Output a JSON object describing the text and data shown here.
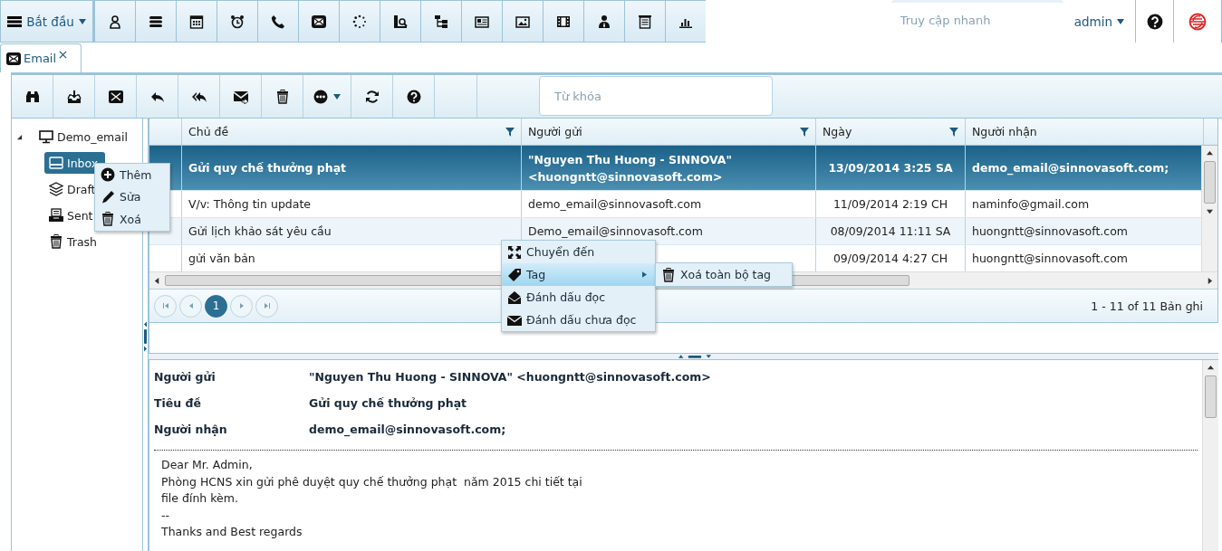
{
  "top_bar": {
    "start_button": "Bắt đầu",
    "quick_access": {
      "placeholder": "Truy cập nhanh"
    },
    "user": "admin"
  },
  "tabs": [
    {
      "label": "Email",
      "selected": true
    }
  ],
  "search": {
    "placeholder": "Từ khóa"
  },
  "folder_tree": {
    "label": "Demo_email",
    "expanded": true,
    "children": [
      {
        "label": "Inbox",
        "selected": true
      },
      {
        "label": "Draft",
        "selected": false
      },
      {
        "label": "Sent",
        "selected": false
      },
      {
        "label": "Trash",
        "selected": false
      }
    ]
  },
  "folder_menu": [
    "Thêm",
    "Sửa",
    "Xoá"
  ],
  "table": {
    "columns": [
      {
        "label": "Chủ đề",
        "filter": true
      },
      {
        "label": "Người gửi",
        "filter": true
      },
      {
        "label": "Ngày",
        "filter": true
      },
      {
        "label": "Người nhận",
        "filter": false
      }
    ],
    "rows": [
      {
        "subject": "Gửi quy chế thưởng phạt",
        "sender": "\"Nguyen Thu Huong - SINNOVA\" <huongntt@sinnovasoft.com>",
        "date": "13/09/2014 3:25 SA",
        "recipient": "demo_email@sinnovasoft.com;",
        "selected": true
      },
      {
        "subject": "V/v: Thông tin update",
        "sender": "demo_email@sinnovasoft.com",
        "date": "11/09/2014 2:19 CH",
        "recipient": "naminfo@gmail.com",
        "selected": false
      },
      {
        "subject": "Gửi lịch khảo sát yêu cầu",
        "sender": "Demo_email@sinnovasoft.com",
        "date": "08/09/2014 11:11 SA",
        "recipient": "huongntt@sinnovasoft.com",
        "selected": false
      },
      {
        "subject": "gửi văn bản",
        "date": "09/09/2014 4:27 CH",
        "recipient": "huongntt@sinnovasoft.com",
        "selected": false
      }
    ]
  },
  "pager": {
    "pages": [
      {
        "label": "1",
        "selected": true
      }
    ],
    "summary": "1 - 11 of 11 Bản ghi"
  },
  "context_menu": {
    "items": [
      {
        "label": "Chuyển đến",
        "highlighted": false
      },
      {
        "label": "Tag",
        "highlighted": true,
        "submenu": [
          "Xoá toàn bộ tag"
        ]
      },
      {
        "label": "Đánh dấu đọc",
        "highlighted": false
      },
      {
        "label": "Đánh dấu chưa đọc",
        "highlighted": false
      }
    ]
  },
  "preview": {
    "fields": [
      {
        "label": "Người gửi",
        "value": "\"Nguyen Thu Huong - SINNOVA\" <huongntt@sinnovasoft.com>"
      },
      {
        "label": "Tiêu đề",
        "value": "Gửi quy chế thưởng phạt"
      },
      {
        "label": "Người nhận",
        "value": "demo_email@sinnovasoft.com;"
      }
    ],
    "body": [
      "Dear Mr. Admin,",
      "Phòng HCNS xin gửi phê duyệt quy chế thưởng phạt  năm 2015 chi tiết tại",
      "file đính kèm.",
      "--",
      "Thanks and Best regards"
    ]
  }
}
